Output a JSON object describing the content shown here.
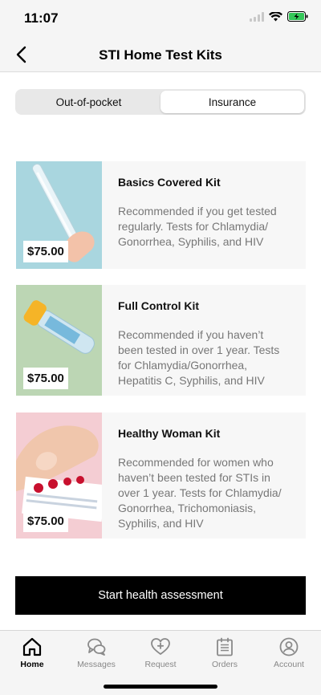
{
  "status_bar": {
    "time": "11:07"
  },
  "nav": {
    "title": "STI Home Test Kits",
    "back_icon": "chevron-left-icon"
  },
  "segmented": {
    "options": [
      "Out-of-pocket",
      "Insurance"
    ],
    "selected": "Insurance"
  },
  "kits": [
    {
      "name": "Basics Covered Kit",
      "price": "$75.00",
      "description": "Recommended if you get tested regularly. Tests for Chlamydia/ Gonorrhea, Syphilis, and HIV",
      "image_bg": "#a9d6df"
    },
    {
      "name": "Full Control Kit",
      "price": "$75.00",
      "description": "Recommended if you haven’t been tested in over 1 year. Tests for Chlamydia/Gonorrhea, Hepatitis C, Syphilis, and HIV",
      "image_bg": "#bcd6b4"
    },
    {
      "name": "Healthy Woman Kit",
      "price": "$75.00",
      "description": "Recommended for women who haven’t been tested for STIs in over 1 year. Tests for Chlamydia/ Gonorrhea, Trichomoniasis, Syphilis, and HIV",
      "image_bg": "#f4cdd3"
    }
  ],
  "cta": {
    "label": "Start health assessment"
  },
  "tabs": [
    {
      "label": "Home",
      "icon": "home-icon",
      "active": true
    },
    {
      "label": "Messages",
      "icon": "messages-icon",
      "active": false
    },
    {
      "label": "Request",
      "icon": "heart-plus-icon",
      "active": false
    },
    {
      "label": "Orders",
      "icon": "calendar-icon",
      "active": false
    },
    {
      "label": "Account",
      "icon": "account-icon",
      "active": false
    }
  ]
}
